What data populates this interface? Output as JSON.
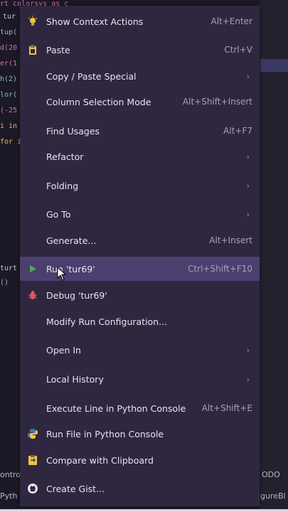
{
  "editor": {
    "code_lines": [
      {
        "text": "rt colorsys as c",
        "color": "#d86fb7"
      },
      {
        "text": "tur",
        "color": "#c0c8e0"
      },
      {
        "text": "tup(",
        "color": "#8fb2d6"
      },
      {
        "text": "d(20",
        "color": "#d86fb7"
      },
      {
        "text": "er(1",
        "color": "#d86fb7"
      },
      {
        "text": "h(2)",
        "color": "#8fb2d6"
      },
      {
        "text": "lor(",
        "color": "#8fb2d6"
      },
      {
        "text": "(-25",
        "color": "#d86fb7"
      },
      {
        "text": "i in",
        "color": "#e0c060"
      },
      {
        "text": "for i",
        "color": "#e0c060"
      },
      {
        "text": "turt",
        "color": "#c0c8e0"
      },
      {
        "text": "()",
        "color": "#8fb2d6"
      }
    ],
    "bottom_left": [
      "ontro",
      "Pyth"
    ],
    "bottom_right": [
      "ODO",
      "gureBl"
    ]
  },
  "menu": {
    "items": [
      {
        "name": "show-context-actions",
        "icon": "lightbulb-icon",
        "label": "Show Context Actions",
        "shortcut": "Alt+Enter",
        "submenu": false
      },
      {
        "name": "paste",
        "icon": "clipboard-icon",
        "label": "Paste",
        "shortcut": "Ctrl+V",
        "submenu": false
      },
      {
        "name": "copy-paste-special",
        "icon": "",
        "label": "Copy / Paste Special",
        "shortcut": "",
        "submenu": true
      },
      {
        "name": "column-selection-mode",
        "icon": "",
        "label": "Column Selection Mode",
        "shortcut": "Alt+Shift+Insert",
        "submenu": false
      },
      {
        "name": "find-usages",
        "icon": "",
        "label": "Find Usages",
        "shortcut": "Alt+F7",
        "submenu": false
      },
      {
        "name": "refactor",
        "icon": "",
        "label": "Refactor",
        "shortcut": "",
        "submenu": true
      },
      {
        "name": "folding",
        "icon": "",
        "label": "Folding",
        "shortcut": "",
        "submenu": true
      },
      {
        "name": "go-to",
        "icon": "",
        "label": "Go To",
        "shortcut": "",
        "submenu": true
      },
      {
        "name": "generate",
        "icon": "",
        "label": "Generate...",
        "shortcut": "Alt+Insert",
        "submenu": false
      },
      {
        "name": "run",
        "icon": "run-icon",
        "label": "Run 'tur69'",
        "shortcut": "Ctrl+Shift+F10",
        "submenu": false,
        "active": true
      },
      {
        "name": "debug",
        "icon": "debug-icon",
        "label": "Debug 'tur69'",
        "shortcut": "",
        "submenu": false
      },
      {
        "name": "modify-run-configuration",
        "icon": "",
        "label": "Modify Run Configuration...",
        "shortcut": "",
        "submenu": false
      },
      {
        "name": "open-in",
        "icon": "",
        "label": "Open In",
        "shortcut": "",
        "submenu": true
      },
      {
        "name": "local-history",
        "icon": "",
        "label": "Local History",
        "shortcut": "",
        "submenu": true
      },
      {
        "name": "execute-line-console",
        "icon": "",
        "label": "Execute Line in Python Console",
        "shortcut": "Alt+Shift+E",
        "submenu": false
      },
      {
        "name": "run-file-console",
        "icon": "python-icon",
        "label": "Run File in Python Console",
        "shortcut": "",
        "submenu": false
      },
      {
        "name": "compare-clipboard",
        "icon": "compare-icon",
        "label": "Compare with Clipboard",
        "shortcut": "",
        "submenu": false
      },
      {
        "name": "create-gist",
        "icon": "github-icon",
        "label": "Create Gist...",
        "shortcut": "",
        "submenu": false
      }
    ]
  },
  "colors": {
    "menu_bg": "#2f2740",
    "active_bg": "#4a3f6e",
    "run_green": "#4caf50",
    "debug_red": "#e05561"
  }
}
